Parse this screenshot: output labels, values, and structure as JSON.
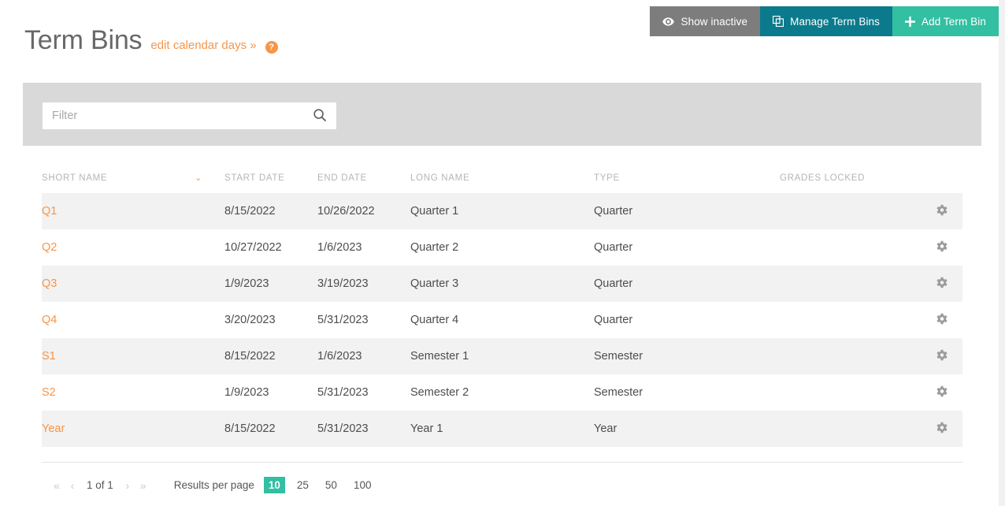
{
  "topbar": {
    "buttons": [
      {
        "label": "Show inactive",
        "icon": "eye-icon",
        "style": "gray"
      },
      {
        "label": "Manage Term Bins",
        "icon": "copy-icon",
        "style": "blue"
      },
      {
        "label": "Add Term Bin",
        "icon": "plus-icon",
        "style": "green"
      }
    ]
  },
  "header": {
    "title": "Term Bins",
    "sublink": "edit calendar days »",
    "help_glyph": "?"
  },
  "filter": {
    "placeholder": "Filter",
    "value": "",
    "search_icon": "search-icon"
  },
  "table": {
    "columns": [
      "SHORT NAME",
      "START DATE",
      "END DATE",
      "LONG NAME",
      "TYPE",
      "GRADES LOCKED"
    ],
    "sort_column": "SHORT NAME",
    "sort_caret": "⌄",
    "rows": [
      {
        "short_name": "Q1",
        "start_date": "8/15/2022",
        "end_date": "10/26/2022",
        "long_name": "Quarter 1",
        "type": "Quarter",
        "grades_locked": ""
      },
      {
        "short_name": "Q2",
        "start_date": "10/27/2022",
        "end_date": "1/6/2023",
        "long_name": "Quarter 2",
        "type": "Quarter",
        "grades_locked": ""
      },
      {
        "short_name": "Q3",
        "start_date": "1/9/2023",
        "end_date": "3/19/2023",
        "long_name": "Quarter 3",
        "type": "Quarter",
        "grades_locked": ""
      },
      {
        "short_name": "Q4",
        "start_date": "3/20/2023",
        "end_date": "5/31/2023",
        "long_name": "Quarter 4",
        "type": "Quarter",
        "grades_locked": ""
      },
      {
        "short_name": "S1",
        "start_date": "8/15/2022",
        "end_date": "1/6/2023",
        "long_name": "Semester 1",
        "type": "Semester",
        "grades_locked": ""
      },
      {
        "short_name": "S2",
        "start_date": "1/9/2023",
        "end_date": "5/31/2023",
        "long_name": "Semester 2",
        "type": "Semester",
        "grades_locked": ""
      },
      {
        "short_name": "Year",
        "start_date": "8/15/2022",
        "end_date": "5/31/2023",
        "long_name": "Year 1",
        "type": "Year",
        "grades_locked": ""
      }
    ],
    "row_action_icon": "gear-icon"
  },
  "pagination": {
    "first": "«",
    "prev": "‹",
    "page_status": "1 of 1",
    "next": "›",
    "last": "»",
    "results_per_page_label": "Results per page",
    "options": [
      "10",
      "25",
      "50",
      "100"
    ],
    "selected": "10"
  },
  "colors": {
    "accent_orange": "#f79548",
    "teal_green": "#33bfa1",
    "petrol_blue": "#0b7a8c",
    "gray_button": "#7d7d7d",
    "panel_gray": "#d9d9d9",
    "row_alt": "#f2f2f2"
  }
}
